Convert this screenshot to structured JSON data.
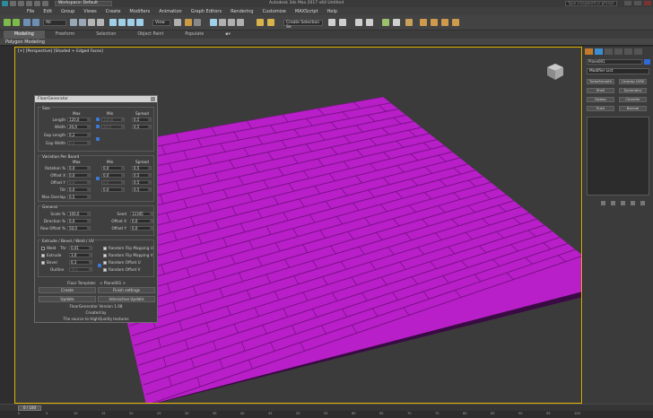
{
  "window": {
    "workspace": "Workspace: Default",
    "title": "Autodesk 3ds Max 2017 x64   Untitled",
    "search_placeholder": "Type a keyword or phrase"
  },
  "menu": [
    "File",
    "Edit",
    "Group",
    "Views",
    "Create",
    "Modifiers",
    "Animation",
    "Graph Editors",
    "Rendering",
    "Customize",
    "MAXScript",
    "Help"
  ],
  "toolbar": {
    "selection_filter": "All",
    "view_combo": "View",
    "named_sel": "Create Selection Se"
  },
  "ribbon": {
    "tabs": [
      "Modeling",
      "Freeform",
      "Selection",
      "Object Paint",
      "Populate"
    ],
    "active_tab": "Modeling",
    "panel": "Polygon Modeling"
  },
  "viewport": {
    "label": "[+] [Perspective] [Shaded + Edged Faces]",
    "floor_color": "#b81fc8",
    "seam_color": "#7a1188"
  },
  "dialog": {
    "title": "FloorGenerator",
    "size": {
      "title": "Size",
      "headers": {
        "max": "Max",
        "min": "Min",
        "spread": "Spread"
      },
      "rows": [
        {
          "label": "Length",
          "max": "120,0",
          "min": "120,0",
          "spread": "0,5"
        },
        {
          "label": "Width",
          "max": "20,0",
          "min": "20,0",
          "spread": "0,5"
        },
        {
          "label": "Gap Length",
          "max": "0,2"
        },
        {
          "label": "Gap Width",
          "max": "0,2"
        }
      ]
    },
    "variation": {
      "title": "Variation Per Board",
      "headers": {
        "max": "Max",
        "min": "Min",
        "spread": "Spread"
      },
      "rows": [
        {
          "label": "Rotation %",
          "max": "0,0",
          "min": "0,0",
          "spread": "0,5"
        },
        {
          "label": "Offset X",
          "max": "0,0",
          "min": "0,0",
          "spread": "0,5"
        },
        {
          "label": "Offset Y",
          "max": "0,0",
          "min": "0,0",
          "spread": "0,5"
        },
        {
          "label": "Tilt",
          "max": "0,0",
          "min": "0,0",
          "spread": "0,5"
        },
        {
          "label": "Max Overlap",
          "max": "0,5"
        }
      ]
    },
    "general": {
      "title": "General",
      "left": [
        {
          "label": "Scale %",
          "value": "100,0"
        },
        {
          "label": "Direction %",
          "value": "0,0"
        },
        {
          "label": "Row Offset %",
          "value": "50,0"
        }
      ],
      "right": [
        {
          "label": "Seed",
          "value": "12345"
        },
        {
          "label": "Offset X",
          "value": "0,0"
        },
        {
          "label": "Offset Y",
          "value": "0,0"
        }
      ]
    },
    "extrude": {
      "title": "Extrude / Bevel / Weld / UV",
      "left": [
        {
          "label": "Weld",
          "sub": "Thr",
          "value": "0,01",
          "checked": false
        },
        {
          "label": "Extrude",
          "value": "3,0",
          "checked": true
        },
        {
          "label": "Bevel",
          "value": "0,3",
          "checked": true
        },
        {
          "label": "Outline",
          "value": "-0,1",
          "checked": false
        }
      ],
      "right": [
        {
          "label": "Random Flip Mapping U",
          "checked": true
        },
        {
          "label": "Random Flip Mapping V",
          "checked": true
        },
        {
          "label": "Random Offset U",
          "checked": true
        },
        {
          "label": "Random Offset V",
          "checked": true
        }
      ]
    },
    "template_label": "Floor Template:",
    "template_value": "< Plane001 >",
    "buttons": {
      "create": "Create",
      "finish": "Finish settings",
      "update": "Update",
      "interactive": "Interactive Update"
    },
    "info": {
      "version": "FloorGenerator Version 1.08",
      "created_by": "Created by",
      "source": "The source to HighQuality textures"
    }
  },
  "command_panel": {
    "object_name": "Plane001",
    "object_color": "#2f6bd8",
    "modifier_list": "Modifier List",
    "modifier_buttons": [
      "TurboSmooth",
      "Unwrap UVW",
      "Shell",
      "Symmetry",
      "Sweep",
      "Chamfer",
      "Push",
      "Normal"
    ]
  },
  "timeline": {
    "slider": "0 / 100",
    "ticks": [
      "0",
      "5",
      "10",
      "15",
      "20",
      "25",
      "30",
      "35",
      "40",
      "45",
      "50",
      "55",
      "60",
      "65",
      "70",
      "75",
      "80",
      "85",
      "90",
      "95",
      "100"
    ]
  }
}
